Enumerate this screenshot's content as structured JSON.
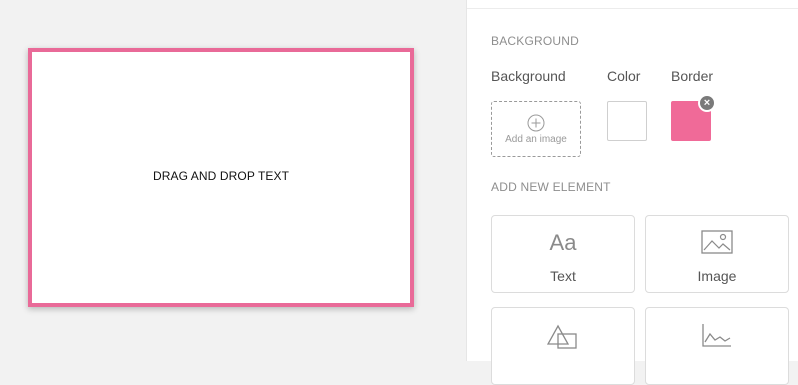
{
  "canvas": {
    "text": "DRAG AND DROP TEXT",
    "border_color": "#e96a98"
  },
  "panel": {
    "background_section": {
      "heading": "BACKGROUND",
      "background_label": "Background",
      "color_label": "Color",
      "border_label": "Border",
      "add_image_label": "Add an image",
      "color_value": "#ffffff",
      "border_value": "#f06a98",
      "remove_glyph": "×"
    },
    "add_element_section": {
      "heading": "ADD NEW ELEMENT",
      "tiles": [
        {
          "label": "Text",
          "icon": "text-icon",
          "icon_text": "Aa"
        },
        {
          "label": "Image",
          "icon": "image-icon"
        },
        {
          "label": "",
          "icon": "shapes-icon"
        },
        {
          "label": "",
          "icon": "chart-icon"
        }
      ]
    }
  }
}
